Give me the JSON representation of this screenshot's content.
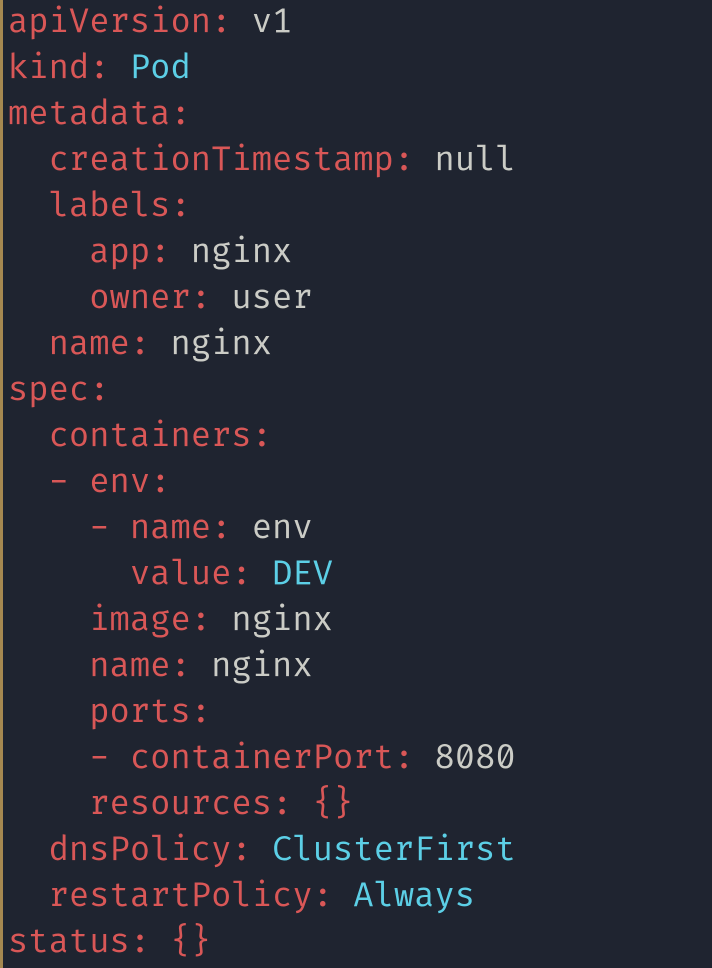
{
  "yaml": {
    "apiVersion": "v1",
    "kind": "Pod",
    "metadata": {
      "creationTimestamp": "null",
      "labels": {
        "app": "nginx",
        "owner": "user"
      },
      "name": "nginx"
    },
    "spec": {
      "containers_key": "containers",
      "container0": {
        "env_key": "env",
        "env0": {
          "name": "env",
          "value": "DEV"
        },
        "image": "nginx",
        "name": "nginx",
        "ports_key": "ports",
        "port0": {
          "containerPort": "8080"
        },
        "resources_key": "resources",
        "resources_val": "{}"
      },
      "dnsPolicy": "ClusterFirst",
      "restartPolicy": "Always"
    },
    "status_key": "status",
    "status_val": "{}"
  },
  "keys": {
    "apiVersion": "apiVersion",
    "kind": "kind",
    "metadata": "metadata",
    "creationTimestamp": "creationTimestamp",
    "labels": "labels",
    "app": "app",
    "owner": "owner",
    "name": "name",
    "spec": "spec",
    "containers": "containers",
    "env": "env",
    "value": "value",
    "image": "image",
    "ports": "ports",
    "containerPort": "containerPort",
    "resources": "resources",
    "dnsPolicy": "dnsPolicy",
    "restartPolicy": "restartPolicy",
    "status": "status"
  }
}
